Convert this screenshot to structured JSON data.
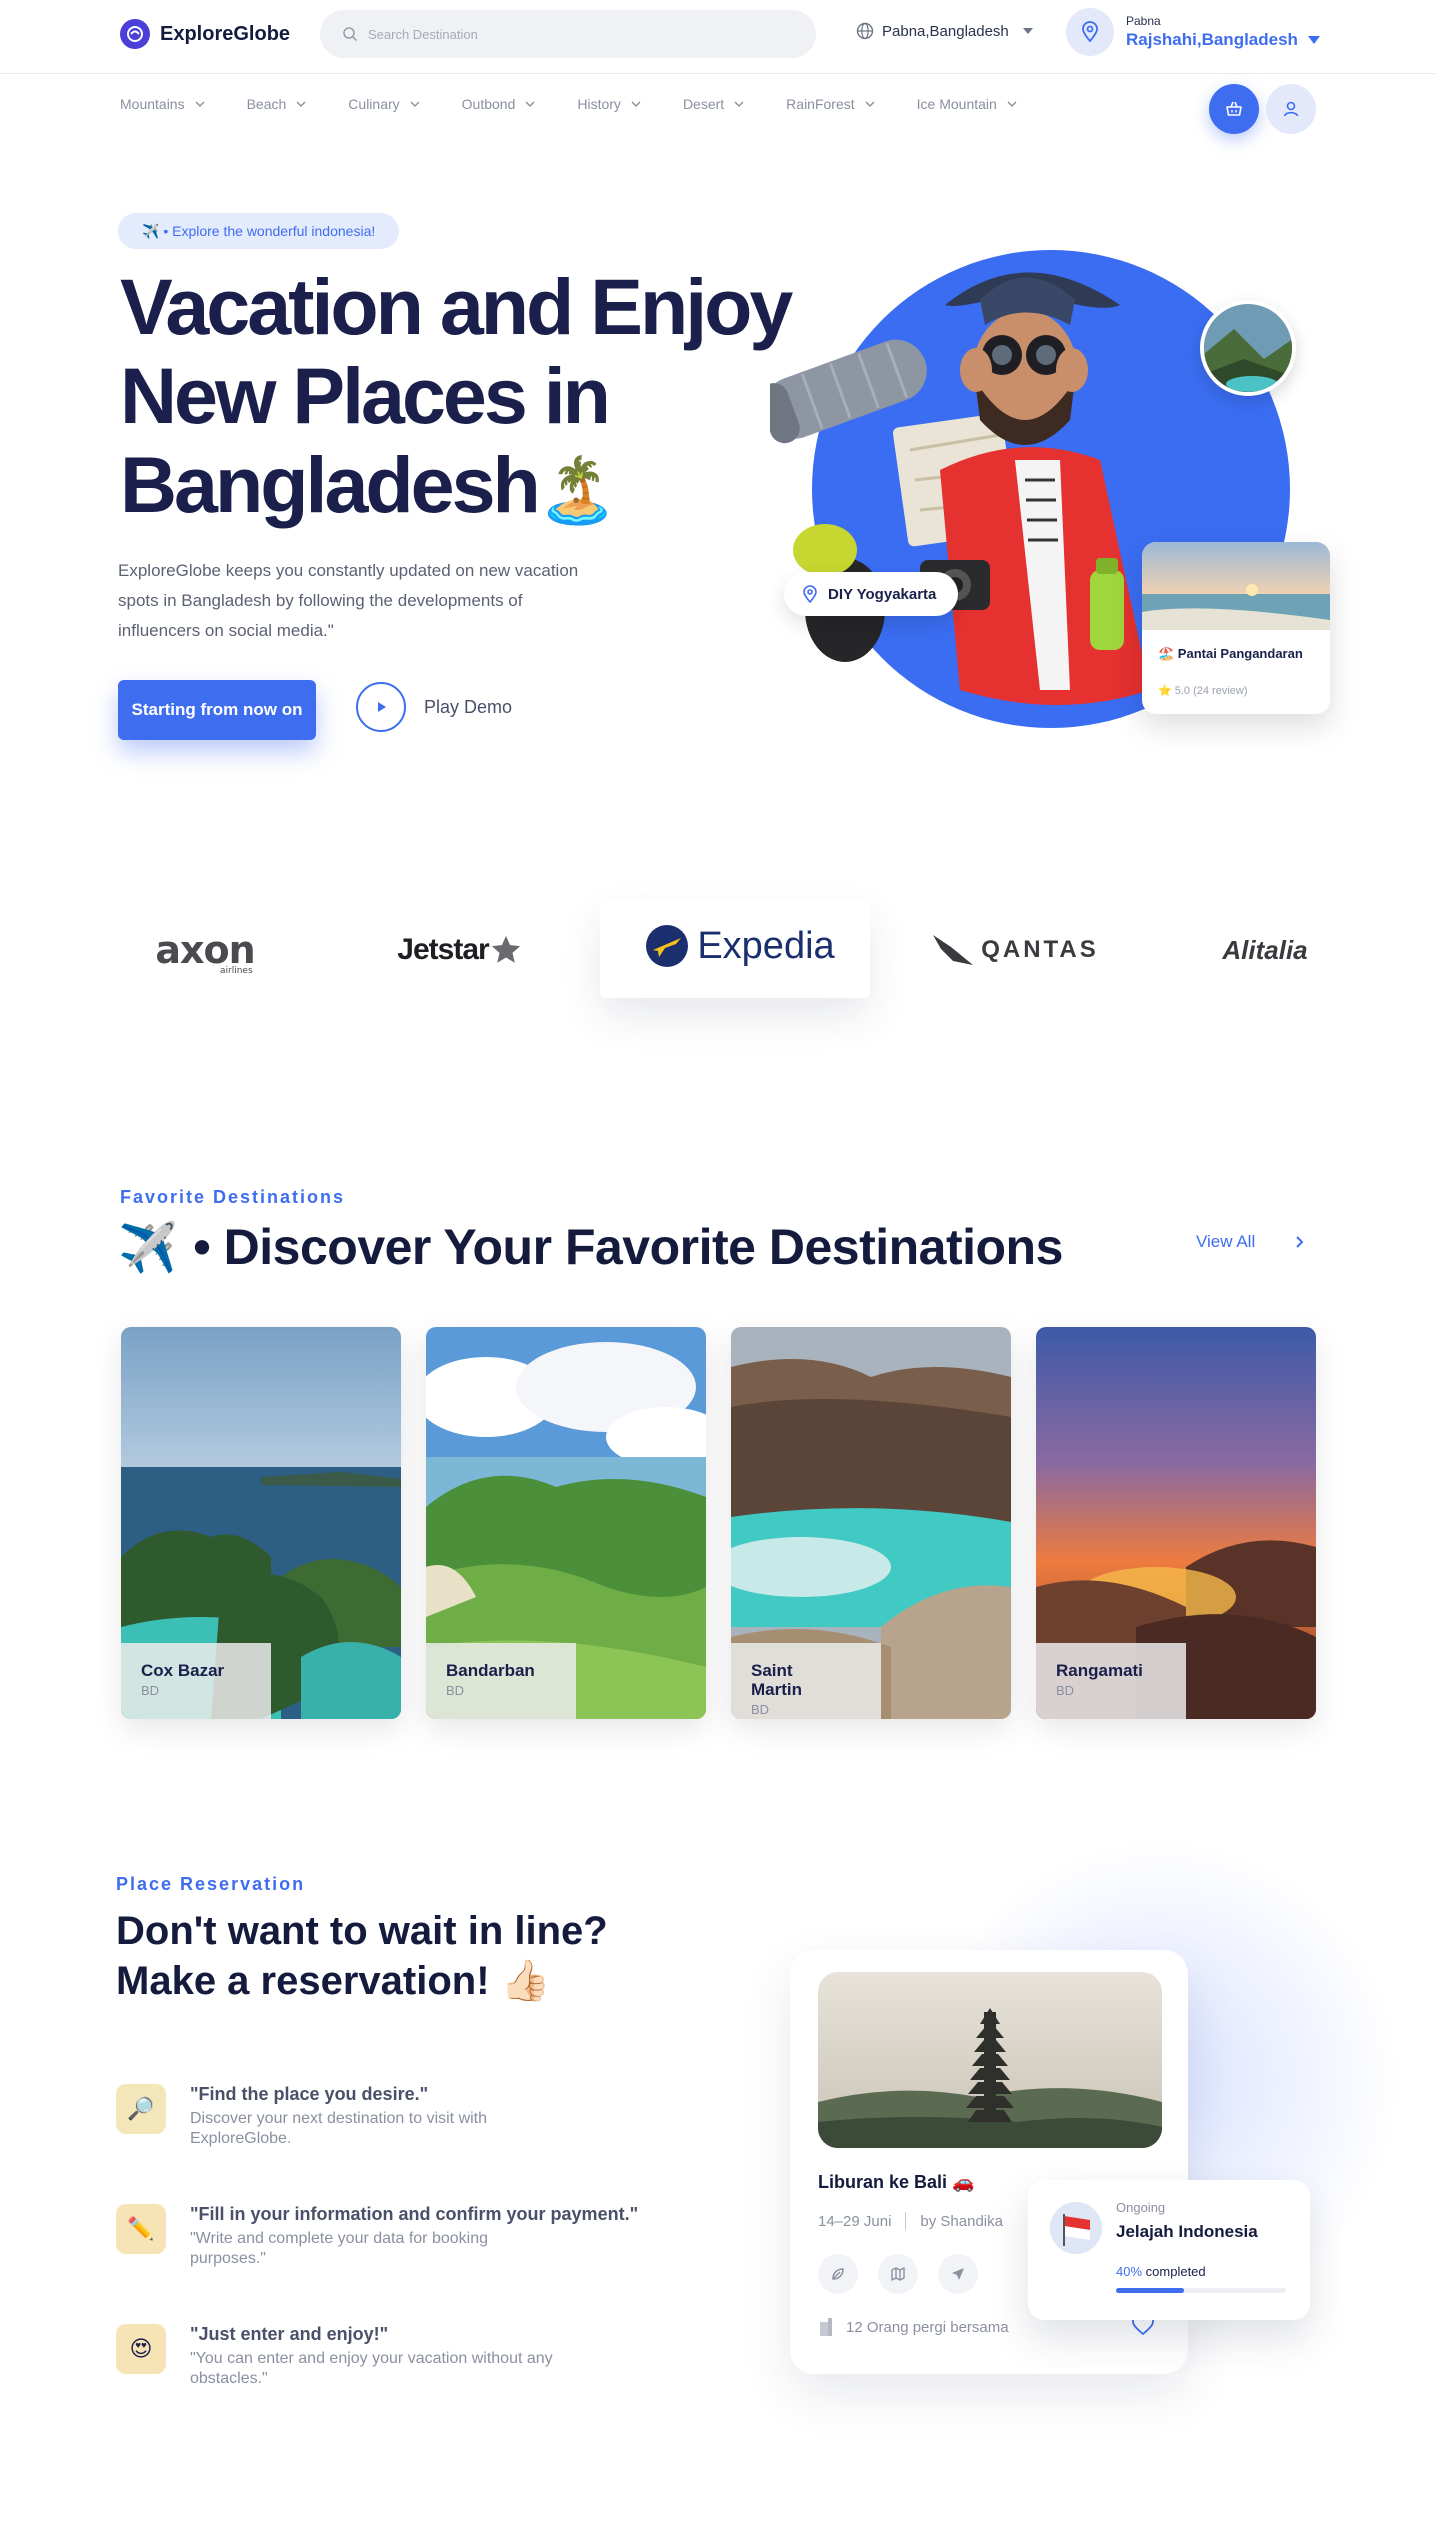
{
  "brand": {
    "name": "ExploreGlobe",
    "accent": "#3e6df0"
  },
  "header": {
    "search_placeholder": "Search Destination",
    "language": "Pabna,Bangladesh",
    "location_small": "Pabna",
    "location_big": "Rajshahi,Bangladesh"
  },
  "categories": [
    "Mountains",
    "Beach",
    "Culinary",
    "Outbond",
    "History",
    "Desert",
    "RainForest",
    "Ice Mountain"
  ],
  "hero": {
    "badge": "✈️ • Explore the wonderful indonesia!",
    "title_line1": "Vacation and Enjoy",
    "title_line2": "New Places in",
    "title_line3": "Bangladesh",
    "title_emoji": "🏝️",
    "description": "ExploreGlobe keeps you constantly updated on new vacation spots in Bangladesh by following the developments of influencers on social media.\"",
    "cta": "Starting from now on",
    "play": "Play Demo",
    "pin_label": "DIY Yogyakarta",
    "card_title": "🏖️ Pantai Pangandaran",
    "card_rating": "⭐ 5.0 (24 review)"
  },
  "partners": [
    "axon",
    "airlines",
    "Jetstar",
    "Expedia",
    "QANTAS",
    "Alitalia"
  ],
  "favorites": {
    "label": "Favorite Destinations",
    "emoji": "✈️",
    "title": "• Discover Your Favorite Destinations",
    "view_all": "View All",
    "items": [
      {
        "name": "Cox Bazar",
        "sub": "BD"
      },
      {
        "name": "Bandarban",
        "sub": "BD"
      },
      {
        "name": "Saint Martin",
        "sub": "BD"
      },
      {
        "name": "Rangamati",
        "sub": "BD"
      }
    ]
  },
  "reservation": {
    "label": "Place Reservation",
    "title_line1": "Don't want to wait in line?",
    "title_line2": "Make a reservation! 👍🏻",
    "steps": [
      {
        "icon": "🔎",
        "title": "\"Find the place you desire.\"",
        "text": "Discover your next destination to visit with ExploreGlobe.",
        "color": "#f3e6b8"
      },
      {
        "icon": "✏️",
        "title": "\"Fill in your information and confirm your payment.\"",
        "text": "\"Write and complete your data for booking purposes.\"",
        "color": "#f6e3b6"
      },
      {
        "icon": "😍",
        "title": "\"Just enter and enjoy!\"",
        "text": "\"You can enter and enjoy your vacation without any obstacles.\"",
        "color": "#f6e3b6"
      }
    ],
    "trip": {
      "title": "Liburan ke Bali 🚗",
      "dates": "14–29 Juni",
      "by": "by Shandika",
      "people": "12 Orang pergi bersama"
    },
    "ongoing": {
      "small": "Ongoing",
      "title": "Jelajah Indonesia",
      "percent": "40%",
      "percent_suffix": "completed",
      "progress": 0.4
    }
  }
}
